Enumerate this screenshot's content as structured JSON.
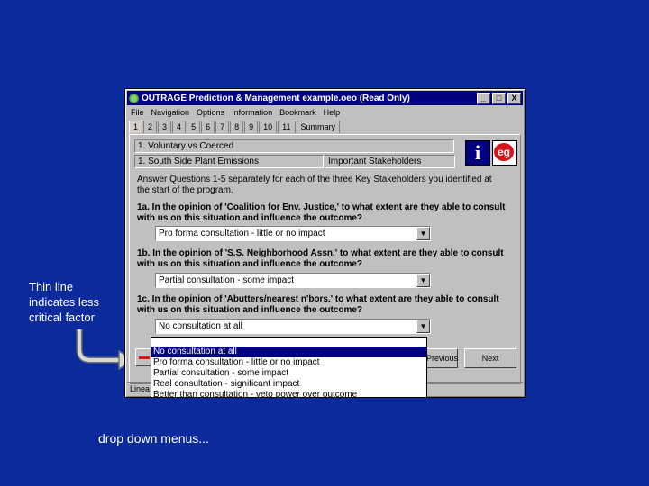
{
  "annotation": "Thin line indicates less critical factor",
  "caption": "drop down menus...",
  "window": {
    "title": "OUTRAGE Prediction & Management   example.oeo (Read Only)",
    "controls": [
      "_",
      "□",
      "X"
    ]
  },
  "menubar": [
    "File",
    "Navigation",
    "Options",
    "Information",
    "Bookmark",
    "Help"
  ],
  "tabs": [
    "1",
    "2",
    "3",
    "4",
    "5",
    "6",
    "7",
    "8",
    "9",
    "10",
    "11",
    "Summary"
  ],
  "header": {
    "section": "1. Voluntary vs Coerced",
    "subsection": "1. South Side Plant Emissions",
    "stakeholders_button": "Important Stakeholders"
  },
  "intro": "Answer Questions 1-5 separately for each of the three Key Stakeholders you identified at the start of the program.",
  "questions": [
    {
      "text": "1a. In the opinion of 'Coalition for Env. Justice,' to what extent are they able to consult with us on this situation and influence the outcome?",
      "value": "Pro forma consultation - little or no impact"
    },
    {
      "text": "1b. In the opinion of 'S.S. Neighborhood Assn.' to what extent are they able to consult with us on this situation and influence the outcome?",
      "value": "Partial consultation - some impact"
    },
    {
      "text": "1c. In the opinion of 'Abutters/nearest n'bors.' to what extent are they able to consult with us on this situation and influence the outcome?",
      "value": "No consultation at all"
    }
  ],
  "dropdown_options": [
    "No consultation at all",
    "Pro forma consultation - little or no impact",
    "Partial consultation - some impact",
    "Real consultation - significant impact",
    "Better than consultation - veto power over outcome"
  ],
  "buttons": {
    "previous": "Previous",
    "next": "Next"
  },
  "status": "Linea"
}
